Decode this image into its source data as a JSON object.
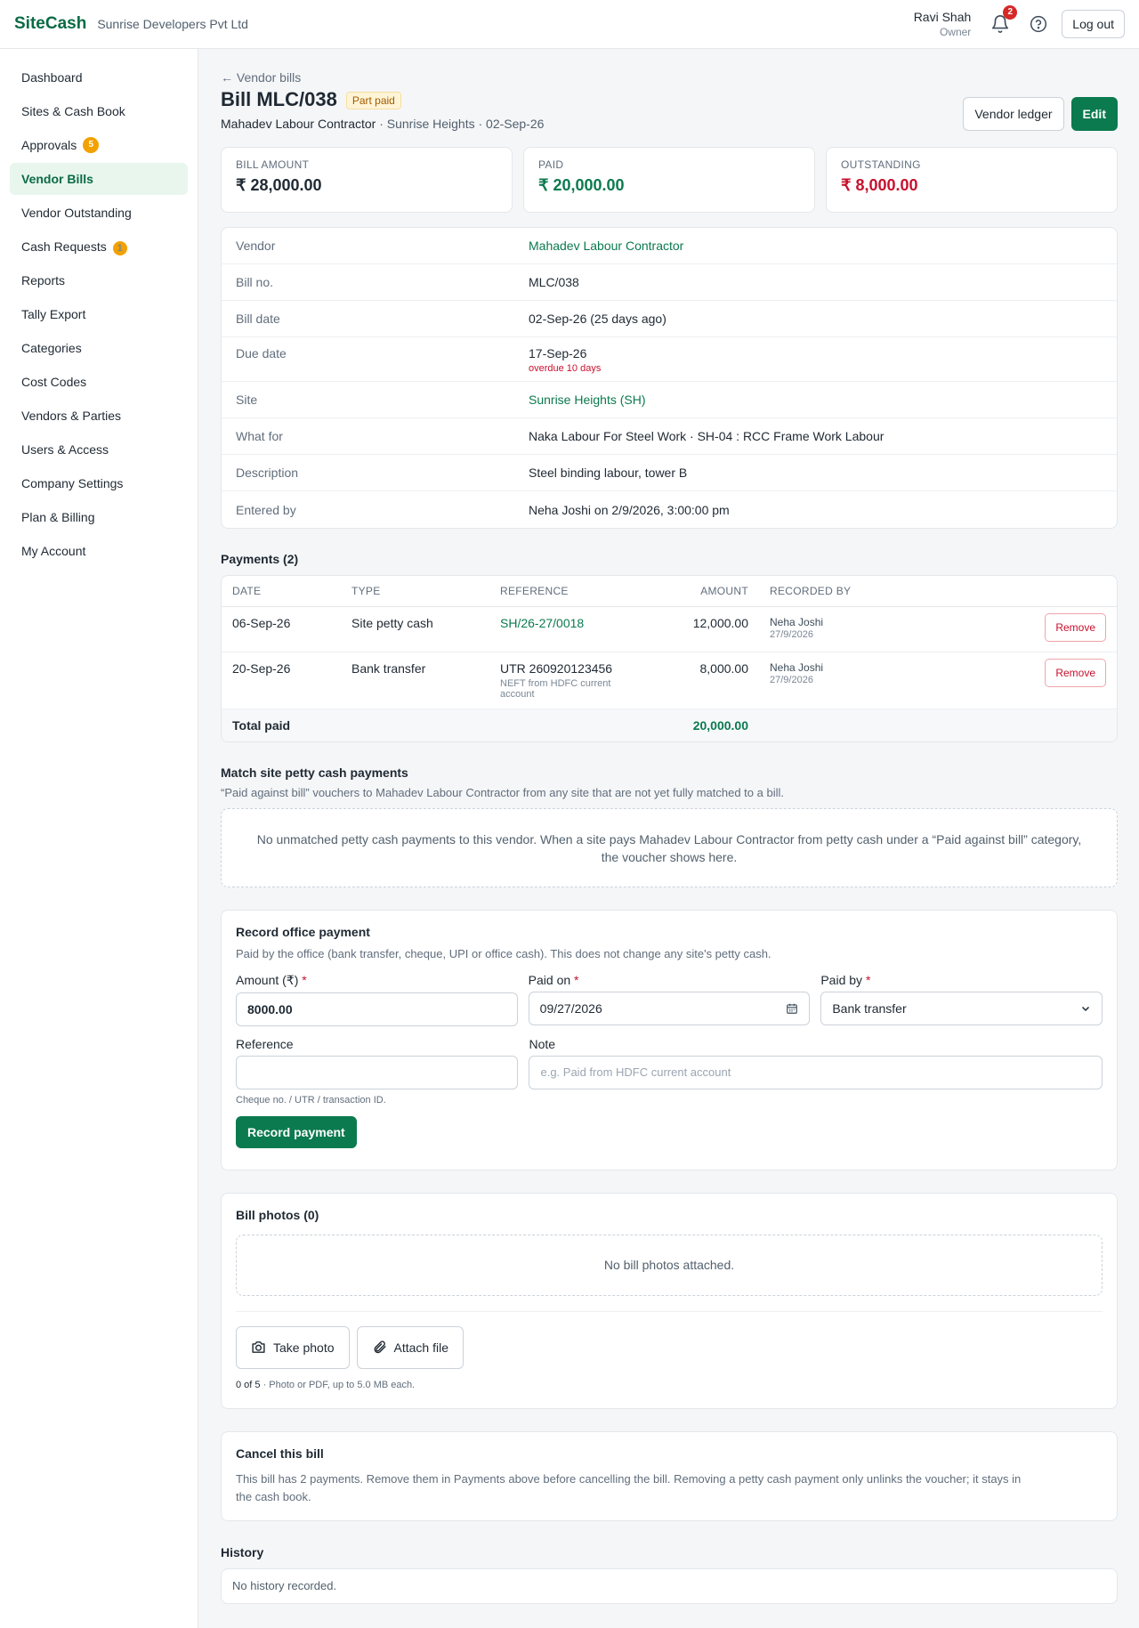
{
  "topbar": {
    "brand": "SiteCash",
    "company": "Sunrise Developers Pvt Ltd",
    "user_name": "Ravi Shah",
    "user_role": "Owner",
    "notification_count": "2",
    "logout_label": "Log out"
  },
  "sidebar": {
    "items": [
      {
        "label": "Dashboard"
      },
      {
        "label": "Sites & Cash Book"
      },
      {
        "label": "Approvals",
        "badge": "5"
      },
      {
        "label": "Vendor Bills",
        "active": true
      },
      {
        "label": "Vendor Outstanding"
      },
      {
        "label": "Cash Requests",
        "badge": "1"
      },
      {
        "label": "Reports"
      },
      {
        "label": "Tally Export"
      },
      {
        "label": "Categories"
      },
      {
        "label": "Cost Codes"
      },
      {
        "label": "Vendors & Parties"
      },
      {
        "label": "Users & Access"
      },
      {
        "label": "Company Settings"
      },
      {
        "label": "Plan & Billing"
      },
      {
        "label": "My Account"
      }
    ]
  },
  "header": {
    "back_label": "← Vendor bills",
    "title": "Bill MLC/038",
    "status": "Part paid",
    "vendor": "Mahadev Labour Contractor",
    "subtitle_rest": " · Sunrise Heights · 02-Sep-26",
    "vendor_ledger_label": "Vendor ledger",
    "edit_label": "Edit"
  },
  "summary": {
    "bill_amount_label": "BILL AMOUNT",
    "bill_amount": "₹ 28,000.00",
    "paid_label": "PAID",
    "paid": "₹ 20,000.00",
    "outstanding_label": "OUTSTANDING",
    "outstanding": "₹ 8,000.00"
  },
  "details": {
    "vendor_label": "Vendor",
    "vendor": "Mahadev Labour Contractor",
    "bill_no_label": "Bill no.",
    "bill_no": "MLC/038",
    "bill_date_label": "Bill date",
    "bill_date": "02-Sep-26 (25 days ago)",
    "due_date_label": "Due date",
    "due_date": "17-Sep-26",
    "overdue": "overdue 10 days",
    "site_label": "Site",
    "site": "Sunrise Heights (SH)",
    "what_for_label": "What for",
    "what_for": "Naka Labour For Steel Work · SH-04 : RCC Frame Work Labour",
    "description_label": "Description",
    "description": "Steel binding labour, tower B",
    "entered_by_label": "Entered by",
    "entered_by": "Neha Joshi on 2/9/2026, 3:00:00 pm"
  },
  "payments": {
    "title": "Payments (2)",
    "columns": {
      "date": "DATE",
      "type": "TYPE",
      "reference": "REFERENCE",
      "amount": "AMOUNT",
      "recorded_by": "RECORDED BY"
    },
    "rows": [
      {
        "date": "06-Sep-26",
        "type": "Site petty cash",
        "reference": "SH/26-27/0018",
        "reference_note": "",
        "amount": "12,000.00",
        "recorded_by": "Neha Joshi",
        "recorded_on": "27/9/2026",
        "remove_label": "Remove"
      },
      {
        "date": "20-Sep-26",
        "type": "Bank transfer",
        "reference": "UTR 260920123456",
        "reference_note": "NEFT from HDFC current account",
        "amount": "8,000.00",
        "recorded_by": "Neha Joshi",
        "recorded_on": "27/9/2026",
        "remove_label": "Remove"
      }
    ],
    "total_label": "Total paid",
    "total": "20,000.00"
  },
  "match": {
    "title": "Match site petty cash payments",
    "subtitle": "“Paid against bill” vouchers to Mahadev Labour Contractor from any site that are not yet fully matched to a bill.",
    "empty_line1": "No unmatched petty cash payments to this vendor. When a site pays Mahadev Labour Contractor from petty cash under a “Paid against bill” category,",
    "empty_line2": "the voucher shows here."
  },
  "record": {
    "title": "Record office payment",
    "subtitle": "Paid by the office (bank transfer, cheque, UPI or office cash). This does not change any site's petty cash.",
    "amount_label": "Amount (₹)",
    "amount_value": "8000.00",
    "paid_on_label": "Paid on",
    "paid_on_value": "09/27/2026",
    "paid_by_label": "Paid by",
    "paid_by_value": "Bank transfer",
    "reference_label": "Reference",
    "reference_value": "",
    "reference_hint": "Cheque no. / UTR / transaction ID.",
    "note_label": "Note",
    "note_placeholder": "e.g. Paid from HDFC current account",
    "submit_label": "Record payment",
    "required_mark": "*"
  },
  "photos": {
    "title": "Bill photos (0)",
    "empty": "No bill photos attached.",
    "take_photo_label": "Take photo",
    "attach_file_label": "Attach file",
    "count": "0 of 5",
    "limits": " · Photo or PDF, up to 5.0 MB each."
  },
  "cancel": {
    "title": "Cancel this bill",
    "text_line1": "This bill has 2 payments. Remove them in Payments above before cancelling the bill. Removing a petty cash payment only unlinks the voucher; it stays in",
    "text_line2": "the cash book."
  },
  "history": {
    "title": "History",
    "empty": "No history recorded."
  },
  "colors": {
    "brand": "#0b6b45",
    "primary_button": "#0b7a4f",
    "outstanding": "#c8102e",
    "badge": "#f2a100"
  }
}
